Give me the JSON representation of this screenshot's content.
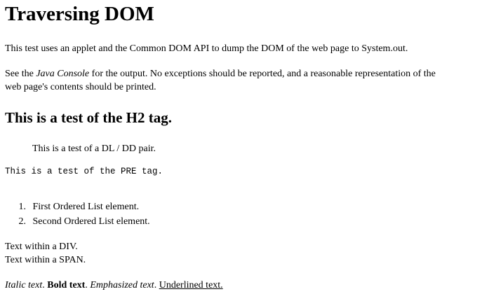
{
  "heading": "Traversing DOM",
  "intro": "This test uses an applet and the Common DOM API to dump the DOM of the web page to System.out.",
  "console_paragraph": {
    "prefix": "See the ",
    "emphasis": "Java Console",
    "line1_rest": " for the output. No exceptions should be reported, and a reasonable representation of the",
    "line2": "web page's contents should be printed."
  },
  "h2": "This is a test of the H2 tag.",
  "dd_text": "This is a test of a DL / DD pair.",
  "pre_text": "This is a test of the PRE tag.",
  "ordered_list": [
    {
      "num": "1.",
      "text": "First Ordered List element."
    },
    {
      "num": "2.",
      "text": "Second Ordered List element."
    }
  ],
  "div_text": "Text within a DIV.",
  "span_text": "Text within a SPAN.",
  "inline_styles": {
    "italic": "Italic text",
    "bold": "Bold text",
    "emphasized": "Emphasized text",
    "underlined": "Underlined text.",
    "sep": ". "
  }
}
